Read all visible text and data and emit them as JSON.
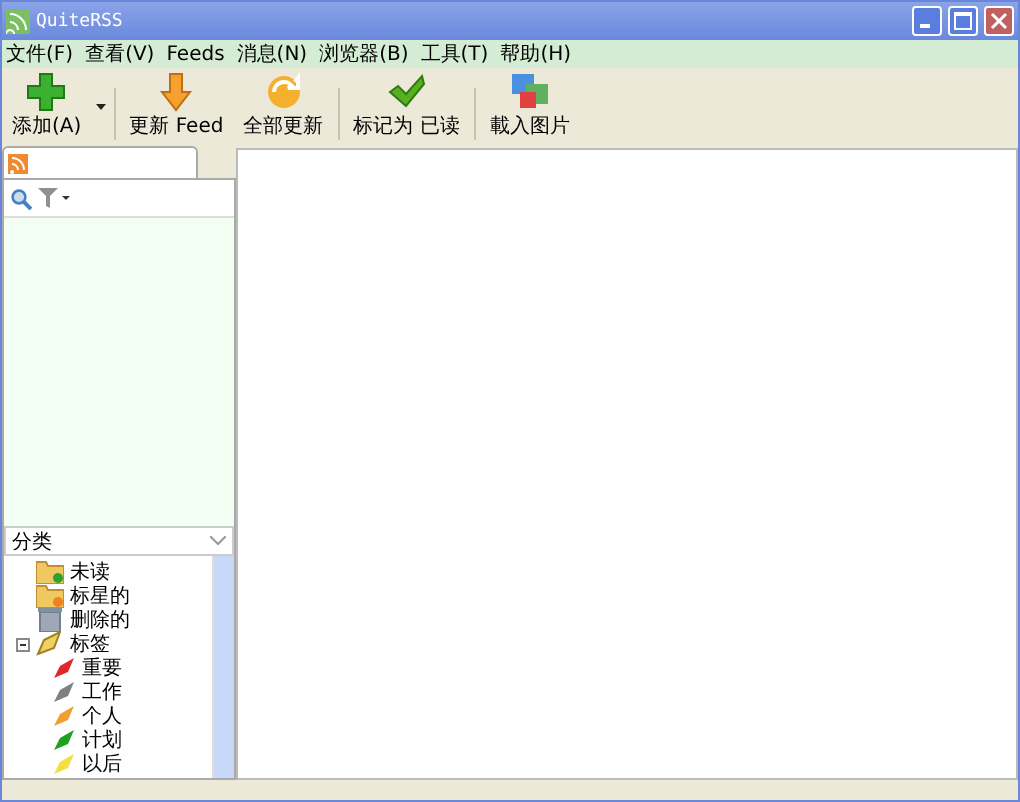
{
  "window": {
    "title": "QuiteRSS"
  },
  "menu": [
    "文件(F)",
    "查看(V)",
    "Feeds",
    "消息(N)",
    "浏览器(B)",
    "工具(T)",
    "帮助(H)"
  ],
  "toolbar": [
    {
      "kind": "add",
      "label": "添加(A)",
      "dropdown": true
    },
    {
      "kind": "update",
      "label": "更新 Feed",
      "dropdown": false
    },
    {
      "kind": "update_all",
      "label": "全部更新",
      "dropdown": false
    },
    {
      "kind": "mark_read",
      "label": "标记为 已读",
      "dropdown": false
    },
    {
      "kind": "load_images",
      "label": "載入图片",
      "dropdown": false
    }
  ],
  "category_select": {
    "value": "分类"
  },
  "categories": [
    {
      "kind": "unread",
      "label": "未读"
    },
    {
      "kind": "starred",
      "label": "标星的"
    },
    {
      "kind": "deleted",
      "label": "删除的"
    },
    {
      "kind": "labels",
      "label": "标签",
      "expanded": true,
      "children": [
        {
          "label": "重要",
          "color": "#e02828"
        },
        {
          "label": "工作",
          "color": "#808080"
        },
        {
          "label": "个人",
          "color": "#f0a030"
        },
        {
          "label": "计划",
          "color": "#20a020"
        },
        {
          "label": "以后",
          "color": "#f0e040"
        }
      ]
    }
  ]
}
